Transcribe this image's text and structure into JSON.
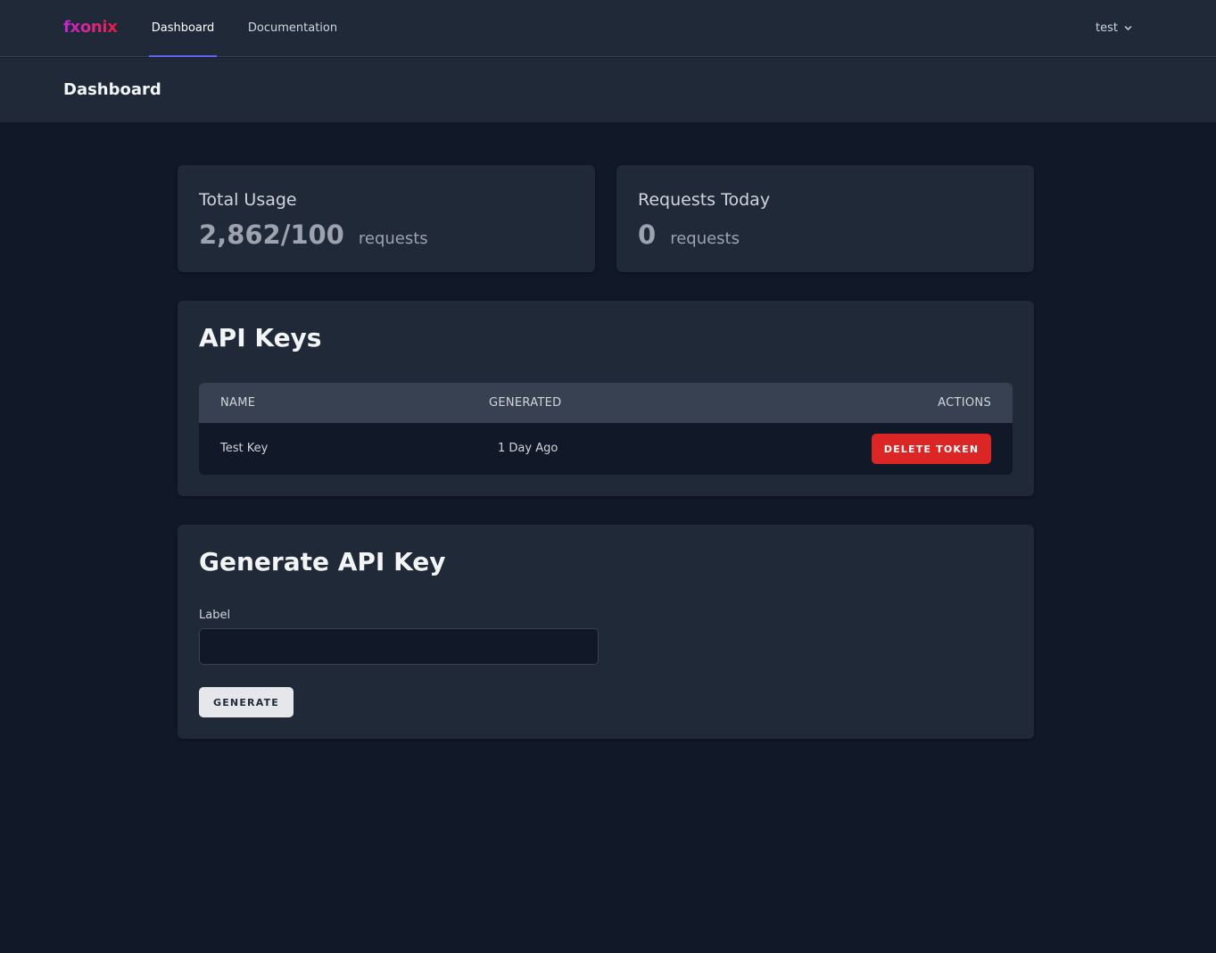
{
  "nav": {
    "logo": "fxonix",
    "links": [
      {
        "label": "Dashboard",
        "active": true
      },
      {
        "label": "Documentation",
        "active": false
      }
    ],
    "user": "test",
    "user_icon": "chevron-down-icon"
  },
  "header": {
    "title": "Dashboard"
  },
  "stats": {
    "total_usage": {
      "title": "Total Usage",
      "value": "2,862/100",
      "unit": "requests"
    },
    "requests_today": {
      "title": "Requests Today",
      "value": "0",
      "unit": "requests"
    }
  },
  "api_keys": {
    "title": "API Keys",
    "columns": [
      "NAME",
      "GENERATED",
      "ACTIONS"
    ],
    "rows": [
      {
        "name": "Test Key",
        "generated": "1 Day Ago",
        "action": "DELETE TOKEN"
      }
    ]
  },
  "generate": {
    "title": "Generate API Key",
    "label": "Label",
    "input_value": "",
    "input_placeholder": "",
    "button": "GENERATE"
  },
  "colors": {
    "accent": "#6366f1",
    "danger": "#dc2626",
    "background": "#111827",
    "surface": "#1f2937"
  }
}
